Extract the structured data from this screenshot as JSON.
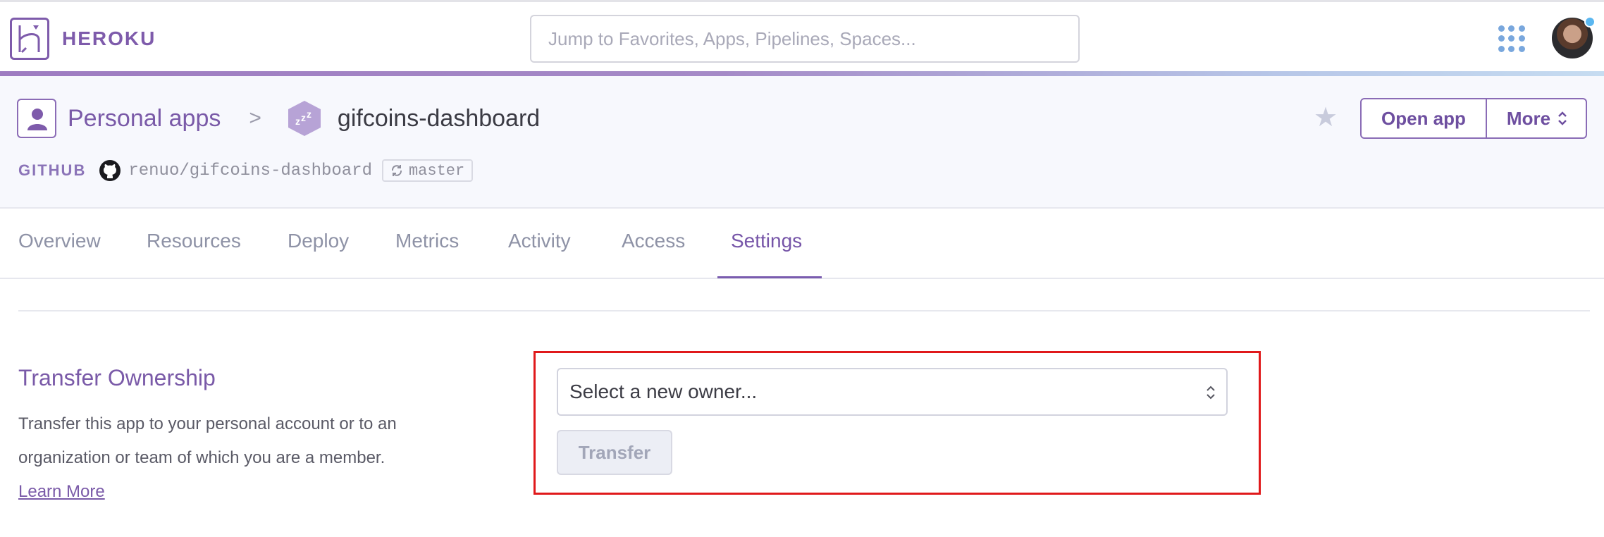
{
  "brand": {
    "name": "HEROKU"
  },
  "search": {
    "placeholder": "Jump to Favorites, Apps, Pipelines, Spaces..."
  },
  "breadcrumb": {
    "owner": "Personal apps",
    "separator": ">",
    "app_name": "gifcoins-dashboard"
  },
  "header_actions": {
    "open_app": "Open app",
    "more": "More"
  },
  "github": {
    "label": "GITHUB",
    "repo": "renuo/gifcoins-dashboard",
    "branch": "master"
  },
  "tabs": [
    {
      "label": "Overview"
    },
    {
      "label": "Resources"
    },
    {
      "label": "Deploy"
    },
    {
      "label": "Metrics"
    },
    {
      "label": "Activity"
    },
    {
      "label": "Access"
    },
    {
      "label": "Settings",
      "active": true
    }
  ],
  "transfer": {
    "title": "Transfer Ownership",
    "description": "Transfer this app to your personal account or to an organization or team of which you are a member.",
    "learn_more": "Learn More",
    "select_placeholder": "Select a new owner...",
    "button": "Transfer"
  },
  "colors": {
    "brand_purple": "#7a5aa8",
    "highlight_border": "#e0191b",
    "notification_dot": "#5bb7f0"
  }
}
